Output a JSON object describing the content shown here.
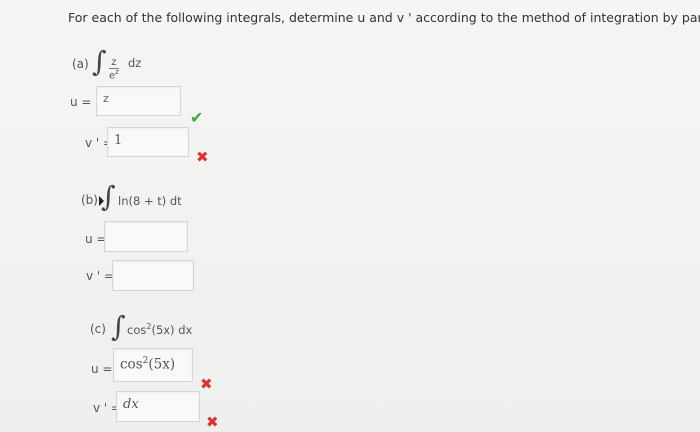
{
  "instructions": "For each of the following integrals, determine u and v ' according to the method of integration by parts.",
  "parts": {
    "a": {
      "label": "(a)",
      "integrand_num": "z",
      "integrand_den": "e",
      "integrand_den_exp": "z",
      "differential": "dz",
      "u_label": "u =",
      "u_value": "z",
      "u_status": "correct",
      "vprime_label": "v ' =",
      "vprime_value": "1",
      "vprime_status": "incorrect"
    },
    "b": {
      "label": "(b)",
      "integrand": "ln(8 + t) dt",
      "u_label": "u =",
      "u_value": "",
      "vprime_label": "v ' =",
      "vprime_value": ""
    },
    "c": {
      "label": "(c)",
      "integrand": "cos",
      "integrand_exp": "2",
      "integrand_tail": "(5x) dx",
      "u_label": "u =",
      "u_value": "cos",
      "u_value_exp": "2",
      "u_value_tail": "(5x)",
      "u_status": "incorrect",
      "vprime_label": "v ' =",
      "vprime_value": "dx",
      "vprime_status": "incorrect"
    }
  },
  "icons": {
    "correct": "checkmark-icon",
    "incorrect": "x-mark-icon"
  },
  "colors": {
    "correct": "#3aa83a",
    "incorrect": "#d33333"
  }
}
